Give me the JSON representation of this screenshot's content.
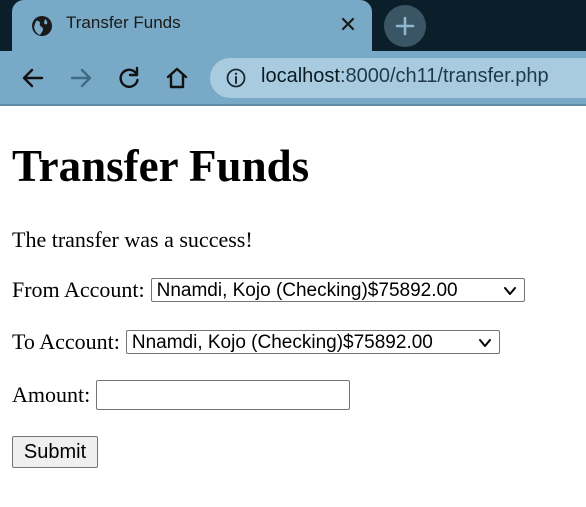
{
  "browser": {
    "tab": {
      "title": "Transfer Funds"
    },
    "address_bar": {
      "host": "localhost",
      "path": ":8000/ch11/transfer.php"
    }
  },
  "colors": {
    "tab_bg": "#78aac7",
    "tabbar_bg": "#0b1f2a",
    "omnibox_bg": "#a8cbe0"
  },
  "page": {
    "heading": "Transfer Funds",
    "message": "The transfer was a success!",
    "form": {
      "from_label": "From Account:",
      "from_selected": "Nnamdi, Kojo (Checking)$75892.00",
      "to_label": "To Account:",
      "to_selected": "Nnamdi, Kojo (Checking)$75892.00",
      "amount_label": "Amount:",
      "amount_value": "",
      "submit_label": "Submit"
    }
  }
}
